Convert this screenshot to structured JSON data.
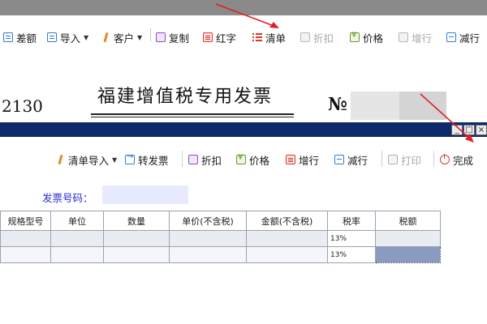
{
  "toolbar": {
    "items": [
      {
        "label": "差额",
        "icon": "blue-doc-icon"
      },
      {
        "label": "导入",
        "icon": "blue-doc-icon"
      },
      {
        "label": "客户",
        "icon": "pen-icon"
      },
      {
        "label": "复制",
        "icon": "copy-icon"
      },
      {
        "label": "红字",
        "icon": "red-doc-icon"
      },
      {
        "label": "清单",
        "icon": "list-icon"
      },
      {
        "label": "折扣",
        "icon": "discount-icon"
      },
      {
        "label": "价格",
        "icon": "price-icon"
      },
      {
        "label": "增行",
        "icon": "add-row-icon"
      },
      {
        "label": "减行",
        "icon": "remove-row-icon"
      }
    ]
  },
  "invoice": {
    "title": "福建增值税专用发票",
    "code_fragment": "2130",
    "number_sign": "№"
  },
  "dialog": {
    "toolbar": [
      {
        "label": "清单导入",
        "icon": "import-list-icon"
      },
      {
        "label": "转发票",
        "icon": "convert-invoice-icon"
      },
      {
        "label": "折扣",
        "icon": "discount-icon"
      },
      {
        "label": "价格",
        "icon": "price-icon"
      },
      {
        "label": "增行",
        "icon": "add-row-icon"
      },
      {
        "label": "减行",
        "icon": "remove-row-icon"
      },
      {
        "label": "打印",
        "icon": "printer-icon"
      },
      {
        "label": "完成",
        "icon": "power-icon"
      }
    ],
    "invoice_number_label": "发票号码：",
    "invoice_number_value": "",
    "window_buttons": {
      "minimize": "_",
      "maximize": "□",
      "close": "×"
    }
  },
  "table": {
    "columns": [
      "规格型号",
      "单位",
      "数量",
      "单价(不含税)",
      "金额(不含税)",
      "税率",
      "税额"
    ],
    "rows": [
      [
        "",
        "",
        "",
        "",
        "",
        "13%",
        ""
      ],
      [
        "",
        "",
        "",
        "",
        "",
        "13%",
        ""
      ]
    ]
  },
  "colors": {
    "title_bar": "#0d2a6b",
    "annotation_arrow": "#e02020",
    "label_blue": "#2a2ad6",
    "selected_cell": "#8b9bbf"
  }
}
